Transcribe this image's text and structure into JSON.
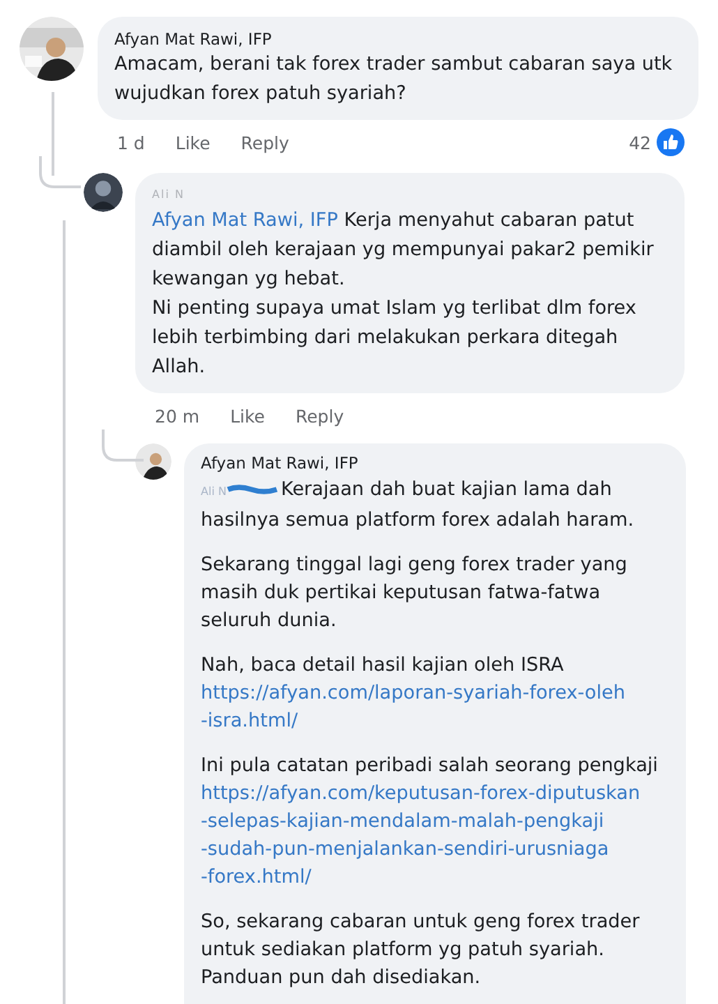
{
  "comment": {
    "author": "Afyan Mat Rawi, IFP",
    "text": "Amacam, berani tak forex trader sambut cabaran saya utk wujudkan forex patuh syariah?",
    "time": "1 d",
    "actions": [
      "Like",
      "Reply"
    ],
    "reactions": "42",
    "reply": {
      "author": "Ali N",
      "mention": "Afyan Mat Rawi, IFP",
      "paragraphs": [
        "Kerja menyahut cabaran patut diambil oleh kerajaan yg mempunyai pakar2 pemikir kewangan yg hebat.",
        "Ni penting supaya umat Islam yg terlibat dlm forex lebih terbimbing dari melakukan perkara ditegah Allah."
      ],
      "time": "20 m",
      "actions": [
        "Like",
        "Reply"
      ],
      "reply": {
        "author": "Afyan Mat Rawi, IFP",
        "mention": "Ali N",
        "blocks": [
          {
            "kind": "text",
            "text": "Kerajaan dah buat kajian lama dah hasilnya semua platform forex adalah haram."
          },
          {
            "kind": "gap"
          },
          {
            "kind": "text",
            "text": "Sekarang tinggal lagi geng forex trader yang masih duk pertikai keputusan fatwa-fatwa seluruh dunia."
          },
          {
            "kind": "gap"
          },
          {
            "kind": "text",
            "text": "Nah, baca detail hasil kajian oleh ISRA"
          },
          {
            "kind": "link",
            "text": "https://afyan.com/laporan-syariah-forex-oleh -isra.html/"
          },
          {
            "kind": "gap"
          },
          {
            "kind": "text",
            "text": "Ini pula catatan peribadi salah seorang pengkaji"
          },
          {
            "kind": "link",
            "text": "https://afyan.com/keputusan-forex-diputuskan -selepas-kajian-mendalam-malah-pengkaji -sudah-pun-menjalankan-sendiri-urusniaga -forex.html/"
          },
          {
            "kind": "gap"
          },
          {
            "kind": "text",
            "text": "So, sekarang cabaran untuk geng forex trader untuk sediakan platform yg patuh syariah. Panduan pun dah disediakan."
          }
        ]
      }
    }
  }
}
